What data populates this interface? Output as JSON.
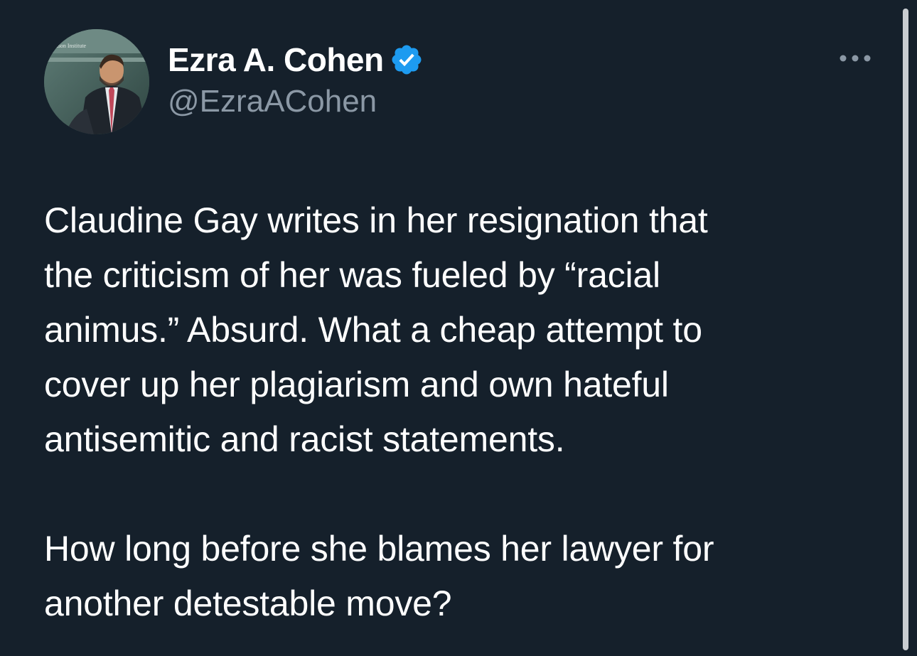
{
  "author": {
    "display_name": "Ezra A. Cohen",
    "handle": "@EzraACohen",
    "verified": true,
    "avatar_backdrop_text": "Hudson Institute"
  },
  "tweet": {
    "paragraphs": [
      {
        "lines": [
          "Claudine Gay writes in her resignation that",
          "the criticism of her was fueled by “racial",
          "animus.” Absurd. What a cheap attempt to",
          "cover up her plagiarism and own hateful",
          "antisemitic and racist statements."
        ]
      },
      {
        "lines": [
          "How long before she blames her lawyer for",
          "another detestable move?"
        ]
      }
    ]
  },
  "icons": {
    "verified": "verified-badge-icon",
    "more": "more-options-icon"
  },
  "colors": {
    "background": "#15202b",
    "text_primary": "#ffffff",
    "text_secondary": "#8b98a5",
    "verified_blue": "#1d9bf0"
  }
}
